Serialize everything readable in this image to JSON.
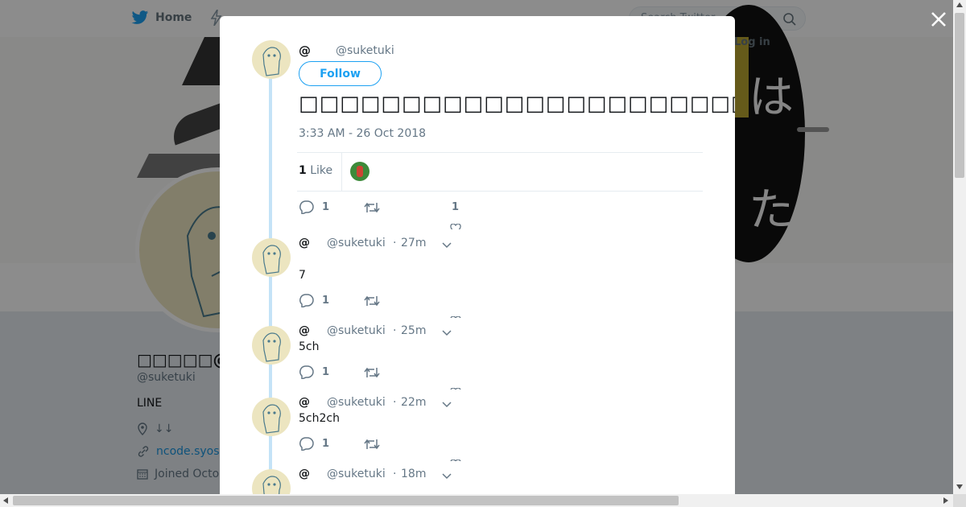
{
  "nav": {
    "home_label": "Home",
    "search_placeholder": "Search Twitter",
    "login_label": "Log in"
  },
  "banner": {
    "kana_top": "は",
    "kana_bottom": "た"
  },
  "profile": {
    "name": "□□□□□@□□",
    "handle": "@suketuki",
    "bio": "LINE",
    "location": "↓↓",
    "link": "ncode.syosetu",
    "joined": "Joined Octo"
  },
  "main_tweet": {
    "name": "@",
    "handle": "@suketuki",
    "follow_label": "Follow",
    "text": "□□□□□□□□□□□□□□□□□□□□□□□□□□□□□□□□□□□□□□□□□□□□□□□□",
    "timestamp": "3:33 AM - 26 Oct 2018",
    "likes_count": "1",
    "likes_label": "Like",
    "reply_count": "1",
    "like_action_count": "1"
  },
  "replies": [
    {
      "name": "@",
      "handle": "@suketuki",
      "time": "27m",
      "text": "7",
      "reply_count": "1"
    },
    {
      "name": "@",
      "handle": "@suketuki",
      "time": "25m",
      "text": "5ch",
      "reply_count": "1"
    },
    {
      "name": "@",
      "handle": "@suketuki",
      "time": "22m",
      "text": "5ch2ch",
      "reply_count": "1"
    },
    {
      "name": "@",
      "handle": "@suketuki",
      "time": "18m",
      "text": "",
      "reply_count": ""
    }
  ],
  "colors": {
    "accent": "#1da1f2",
    "thread_line": "#c4e3f7",
    "muted": "#657786"
  }
}
